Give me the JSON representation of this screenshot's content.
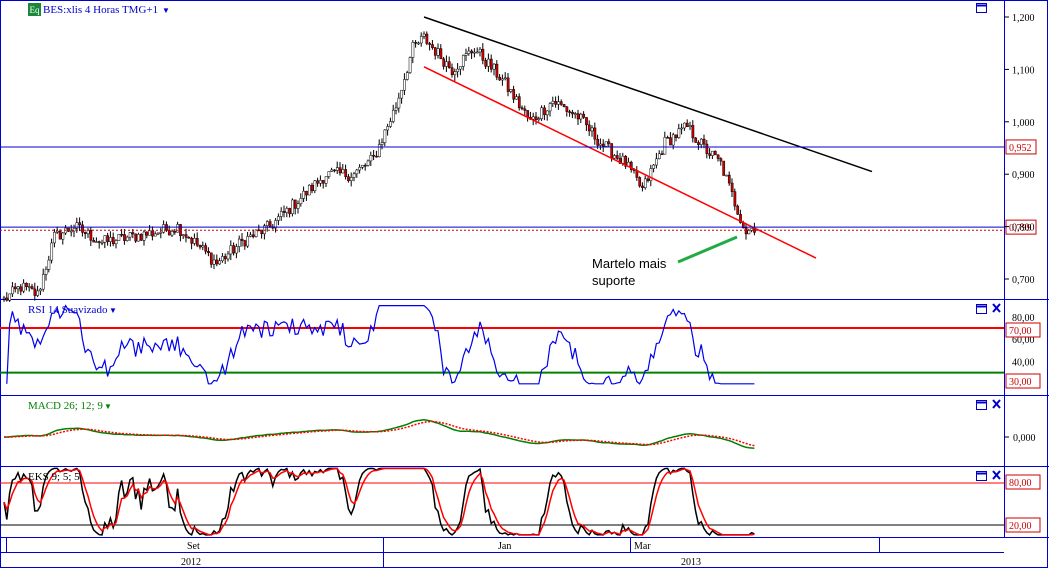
{
  "main": {
    "eq_badge": "Eq",
    "title": "BES:xlis 4 Horas TMG+1",
    "axis_ticks": [
      "1,200",
      "1,100",
      "1,000",
      "0,900",
      "0,800",
      "0,700"
    ],
    "h_lines": [
      {
        "value": 0.952,
        "label": "0,952",
        "color": "#0000cc"
      },
      {
        "value": 0.799,
        "label": "0,799",
        "color": "#0000cc"
      }
    ],
    "annotation": [
      "Martelo mais",
      "suporte"
    ]
  },
  "rsi": {
    "title": "RSI 14 Suavizado",
    "axis_ticks": [
      "80,00",
      "60,00",
      "40,00"
    ],
    "level_high": "70,00",
    "level_low": "30,00"
  },
  "macd": {
    "title": "MACD 26; 12; 9",
    "axis_ticks": [
      "0,000"
    ]
  },
  "stoch": {
    "title": "EKS 9; 5; 5",
    "level_high": "80,00",
    "level_low": "20,00"
  },
  "time_axis": {
    "months": [
      "Set",
      "Jan",
      "Mar"
    ],
    "years": [
      "2012",
      "2013"
    ]
  },
  "colors": {
    "frame": "#0000cc",
    "price_line": "#000000",
    "resistance": "#000000",
    "channel": "#ff0000",
    "rsi_line": "#0000ee",
    "rsi_high": "#ff0000",
    "rsi_low": "#008000",
    "macd_main": "#008000",
    "macd_signal": "#ff0000",
    "label_text": "#cc0000",
    "annotation_arrow": "#22aa44"
  },
  "chart_data": {
    "type": "candlestick",
    "title": "BES:xlis 4 Horas TMG+1",
    "price_anchors": [
      {
        "i": 0,
        "y": 0.66
      },
      {
        "i": 6,
        "y": 0.685
      },
      {
        "i": 12,
        "y": 0.67
      },
      {
        "i": 18,
        "y": 0.78
      },
      {
        "i": 25,
        "y": 0.8
      },
      {
        "i": 35,
        "y": 0.77
      },
      {
        "i": 45,
        "y": 0.78
      },
      {
        "i": 55,
        "y": 0.79
      },
      {
        "i": 62,
        "y": 0.8
      },
      {
        "i": 70,
        "y": 0.76
      },
      {
        "i": 76,
        "y": 0.73
      },
      {
        "i": 86,
        "y": 0.775
      },
      {
        "i": 95,
        "y": 0.8
      },
      {
        "i": 105,
        "y": 0.85
      },
      {
        "i": 115,
        "y": 0.9
      },
      {
        "i": 125,
        "y": 0.9
      },
      {
        "i": 132,
        "y": 0.93
      },
      {
        "i": 140,
        "y": 1.03
      },
      {
        "i": 146,
        "y": 1.14
      },
      {
        "i": 150,
        "y": 1.16
      },
      {
        "i": 160,
        "y": 1.1
      },
      {
        "i": 168,
        "y": 1.14
      },
      {
        "i": 178,
        "y": 1.08
      },
      {
        "i": 188,
        "y": 1.0
      },
      {
        "i": 196,
        "y": 1.04
      },
      {
        "i": 205,
        "y": 1.01
      },
      {
        "i": 213,
        "y": 0.96
      },
      {
        "i": 222,
        "y": 0.92
      },
      {
        "i": 228,
        "y": 0.87
      },
      {
        "i": 236,
        "y": 0.96
      },
      {
        "i": 244,
        "y": 0.99
      },
      {
        "i": 250,
        "y": 0.95
      },
      {
        "i": 256,
        "y": 0.92
      },
      {
        "i": 260,
        "y": 0.86
      },
      {
        "i": 265,
        "y": 0.79
      },
      {
        "i": 268,
        "y": 0.8
      }
    ],
    "candle_count": 269,
    "resistance_line": [
      {
        "i": 150,
        "y": 1.2
      },
      {
        "i": 310,
        "y": 0.905
      }
    ],
    "support_channel": [
      {
        "i": 150,
        "y": 1.105
      },
      {
        "i": 290,
        "y": 0.74
      }
    ],
    "horizontal_levels": [
      0.952,
      0.799
    ],
    "ylim": [
      0.64,
      1.23
    ],
    "rsi": {
      "ylim": [
        10,
        95
      ],
      "levels": [
        70,
        30
      ]
    },
    "stochastic": {
      "ylim": [
        0,
        100
      ],
      "levels": [
        80,
        20
      ]
    },
    "x_labels": [
      "Set",
      "Jan",
      "Mar"
    ],
    "year_labels": [
      "2012",
      "2013"
    ]
  }
}
